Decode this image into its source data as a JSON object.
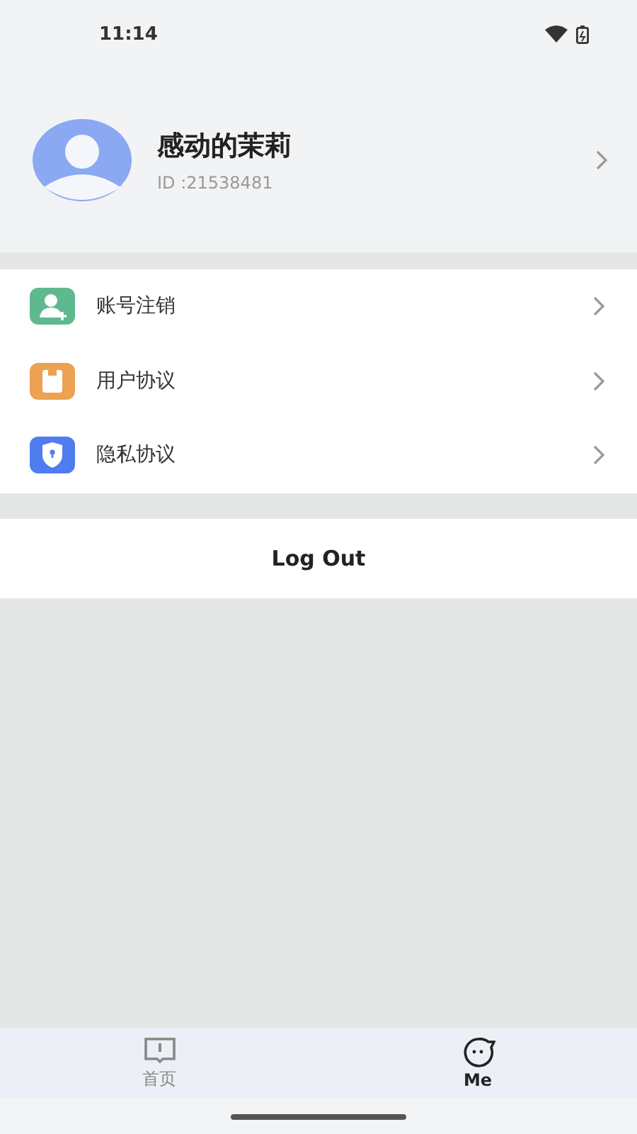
{
  "status_bar": {
    "time": "11:14"
  },
  "profile": {
    "name": "感动的茉莉",
    "id": "ID :21538481"
  },
  "menu": [
    {
      "kind": "account",
      "label": "账号注销"
    },
    {
      "kind": "agreement",
      "label": "用户协议"
    },
    {
      "kind": "privacy",
      "label": "隐私协议"
    }
  ],
  "logout": "Log Out",
  "tabs": [
    {
      "kind": "home",
      "label": "首页",
      "selected": false
    },
    {
      "kind": "me",
      "label": "Me",
      "selected": true
    }
  ]
}
